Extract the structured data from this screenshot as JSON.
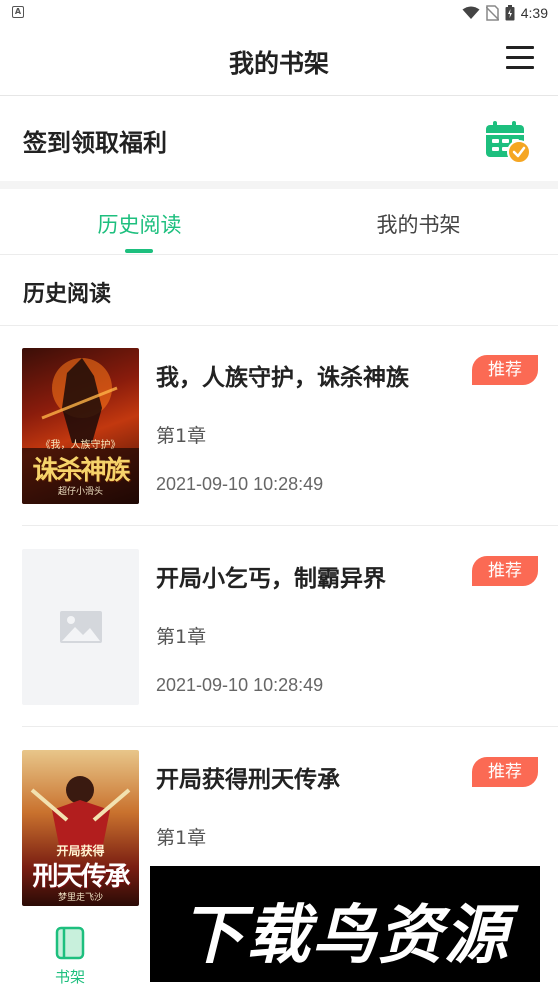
{
  "status_bar": {
    "time": "4:39"
  },
  "header": {
    "title": "我的书架"
  },
  "checkin": {
    "label": "签到领取福利"
  },
  "tabs": [
    {
      "label": "历史阅读",
      "active": true
    },
    {
      "label": "我的书架",
      "active": false
    }
  ],
  "section": {
    "title": "历史阅读"
  },
  "books": [
    {
      "title": "我，人族守护，诛杀神族",
      "chapter": "第1章",
      "time": "2021-09-10 10:28:49",
      "badge": "推荐",
      "cover_text": "诛杀神族",
      "cover_sub": "《我，人族守护》",
      "cover_author": "超仔小滑头"
    },
    {
      "title": "开局小乞丐，制霸异界",
      "chapter": "第1章",
      "time": "2021-09-10 10:28:49",
      "badge": "推荐"
    },
    {
      "title": "开局获得刑天传承",
      "chapter": "第1章",
      "badge": "推荐",
      "cover_text": "刑天传承",
      "cover_sub": "开局获得",
      "cover_author": "梦里走飞沙"
    }
  ],
  "bottom_nav": {
    "shelf_label": "书架"
  },
  "watermark": {
    "text": "下载鸟资源"
  },
  "colors": {
    "accent": "#1dbf7e",
    "badge": "#fb6a54",
    "calendar": "#1dbf7e",
    "check": "#f5a623"
  }
}
